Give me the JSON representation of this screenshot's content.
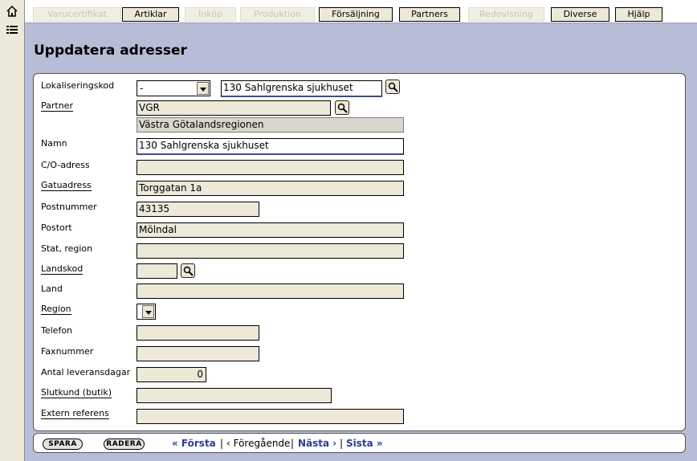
{
  "menu": {
    "tabs": [
      {
        "label": "Varucertifikat",
        "disabled": true
      },
      {
        "label": "Artiklar",
        "disabled": false
      },
      {
        "label": "Inköp",
        "disabled": true
      },
      {
        "label": "Produktion",
        "disabled": true
      },
      {
        "label": "Försäljning",
        "disabled": false
      },
      {
        "label": "Partners",
        "disabled": false
      },
      {
        "label": "Redovisning",
        "disabled": true
      },
      {
        "label": "Diverse",
        "disabled": false
      },
      {
        "label": "Hjälp",
        "disabled": false
      }
    ]
  },
  "page": {
    "title": "Uppdatera adresser"
  },
  "form": {
    "lokaliseringskod": {
      "label": "Lokaliseringskod",
      "select_value": "-",
      "value": "130 Sahlgrenska sjukhuset"
    },
    "partner": {
      "label": "Partner",
      "value": "VGR",
      "name_value": "Västra Götalandsregionen"
    },
    "namn": {
      "label": "Namn",
      "value": "130 Sahlgrenska sjukhuset"
    },
    "co_adress": {
      "label": "C/O-adress",
      "value": ""
    },
    "gatuadress": {
      "label": "Gatuadress",
      "value": "Torggatan 1a"
    },
    "postnummer": {
      "label": "Postnummer",
      "value": "43135"
    },
    "postort": {
      "label": "Postort",
      "value": "Mölndal"
    },
    "stat_region": {
      "label": "Stat, region",
      "value": ""
    },
    "landskod": {
      "label": "Landskod",
      "value": ""
    },
    "land": {
      "label": "Land",
      "value": ""
    },
    "region": {
      "label": "Region",
      "select_value": ""
    },
    "telefon": {
      "label": "Telefon",
      "value": ""
    },
    "faxnummer": {
      "label": "Faxnummer",
      "value": ""
    },
    "antal_leveransdagar": {
      "label": "Antal leveransdagar",
      "value": "0"
    },
    "slutkund": {
      "label": "Slutkund (butik)",
      "value": ""
    },
    "extern_referens": {
      "label": "Extern referens",
      "value": ""
    }
  },
  "actions": {
    "save_label": "SPARA",
    "delete_label": "RADERA"
  },
  "pager": {
    "first": "« Första",
    "prev": "‹ Föregående",
    "next": "Nästa ›",
    "last": "Sista »",
    "sep": "|"
  },
  "icons": {
    "home": "home-icon",
    "list": "list-icon",
    "lookup": "magnifier-icon"
  }
}
